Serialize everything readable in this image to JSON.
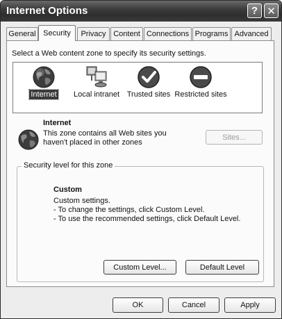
{
  "window": {
    "title": "Internet Options"
  },
  "titlebar": {
    "help_glyph": "?",
    "close_glyph": "✕"
  },
  "tabs": [
    {
      "label": "General"
    },
    {
      "label": "Security"
    },
    {
      "label": "Privacy"
    },
    {
      "label": "Content"
    },
    {
      "label": "Connections"
    },
    {
      "label": "Programs"
    },
    {
      "label": "Advanced"
    }
  ],
  "active_tab": "Security",
  "security": {
    "prompt": "Select a Web content zone to specify its security settings.",
    "zones": [
      {
        "label": "Internet",
        "icon": "globe-icon",
        "selected": true
      },
      {
        "label": "Local intranet",
        "icon": "network-computer-icon",
        "selected": false
      },
      {
        "label": "Trusted sites",
        "icon": "checkmark-icon",
        "selected": false
      },
      {
        "label": "Restricted sites",
        "icon": "no-entry-icon",
        "selected": false
      }
    ],
    "zone_info": {
      "title": "Internet",
      "description": "This zone contains all Web sites you haven't placed in other zones",
      "icon": "globe-icon"
    },
    "sites_button": "Sites...",
    "level_group": {
      "legend": "Security level for this zone",
      "level_title": "Custom",
      "description_lines": [
        "Custom settings.",
        "- To change the settings, click Custom Level.",
        "- To use the recommended settings, click Default Level."
      ],
      "custom_level_button": "Custom Level...",
      "default_level_button": "Default Level"
    }
  },
  "footer": {
    "ok": "OK",
    "cancel": "Cancel",
    "apply": "Apply"
  }
}
